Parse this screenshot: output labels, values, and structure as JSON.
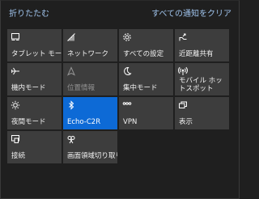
{
  "header": {
    "collapse_label": "折りたたむ",
    "clear_all_label": "すべての通知をクリア"
  },
  "colors": {
    "background": "#1f1f1f",
    "tile": "#3d3d3d",
    "tile_active": "#0d6ad6",
    "link": "#9fc3ec"
  },
  "tiles": [
    {
      "label": "タブレット モード",
      "icon": "tablet-mode-icon",
      "state": "off"
    },
    {
      "label": "ネットワーク",
      "icon": "network-icon",
      "state": "off"
    },
    {
      "label": "すべての設定",
      "icon": "gear-icon",
      "state": "off"
    },
    {
      "label": "近距離共有",
      "icon": "nearby-share-icon",
      "state": "off"
    },
    {
      "label": "機内モード",
      "icon": "airplane-icon",
      "state": "off"
    },
    {
      "label": "位置情報",
      "icon": "location-icon",
      "state": "disabled"
    },
    {
      "label": "集中モード",
      "icon": "moon-icon",
      "state": "off"
    },
    {
      "label": "モバイル ホットスポット",
      "icon": "hotspot-icon",
      "state": "off"
    },
    {
      "label": "夜間モード",
      "icon": "brightness-icon",
      "state": "off"
    },
    {
      "label": "Echo-C2R",
      "icon": "bluetooth-icon",
      "state": "on"
    },
    {
      "label": "VPN",
      "icon": "vpn-icon",
      "state": "off"
    },
    {
      "label": "表示",
      "icon": "project-icon",
      "state": "off"
    },
    {
      "label": "接続",
      "icon": "connect-icon",
      "state": "off"
    },
    {
      "label": "画面領域切り取り",
      "icon": "screen-snip-icon",
      "state": "off"
    }
  ]
}
